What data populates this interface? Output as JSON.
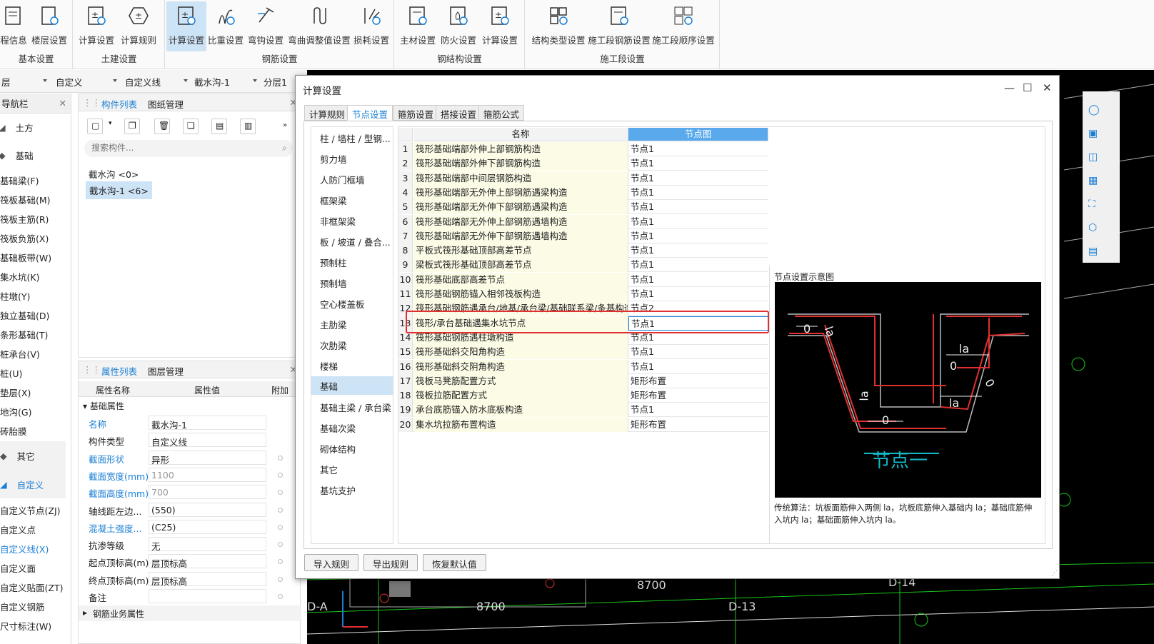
{
  "ribbon": {
    "groups": [
      {
        "title": "基本设置",
        "items": [
          "程信息",
          "楼层设置"
        ]
      },
      {
        "title": "土建设置",
        "items": [
          "计算设置",
          "计算规则"
        ]
      },
      {
        "title": "钢筋设置",
        "items": [
          "计算设置",
          "比重设置",
          "弯钩设置",
          "弯曲调整值设置",
          "损耗设置"
        ]
      },
      {
        "title": "钢结构设置",
        "items": [
          "主材设置",
          "防火设置",
          "计算设置"
        ]
      },
      {
        "title": "施工段设置",
        "items": [
          "结构类型设置",
          "施工段钢筋设置",
          "施工段顺序设置"
        ]
      }
    ]
  },
  "selbar": {
    "s0": "层",
    "s1": "自定义",
    "s2": "自定义线",
    "s3": "截水沟-1",
    "s4": "分层1"
  },
  "nav": {
    "title": "导航栏",
    "cat_tufang": "土方",
    "cat_jichu": "基础",
    "items": [
      "基础梁(F)",
      "筏板基础(M)",
      "筏板主筋(R)",
      "筏板负筋(X)",
      "基础板带(W)",
      "集水坑(K)",
      "柱墩(Y)",
      "独立基础(D)",
      "条形基础(T)",
      "桩承台(V)",
      "桩(U)",
      "垫层(X)",
      "地沟(G)",
      "砖胎膜"
    ],
    "cat_qita": "其它",
    "cat_zidingyi": "自定义",
    "items2": [
      "自定义节点(ZJ)",
      "自定义点",
      "自定义线(X)",
      "自定义面",
      "自定义贴面(ZT)",
      "自定义钢筋",
      "尺寸标注(W)"
    ]
  },
  "comp": {
    "tab1": "构件列表",
    "tab2": "图纸管理",
    "search_placeholder": "搜索构件...",
    "tree_root": "截水沟 <0>",
    "tree_child": "截水沟-1 <6>"
  },
  "props": {
    "tab1": "属性列表",
    "tab2": "图层管理",
    "col1": "属性名称",
    "col2": "属性值",
    "col3": "附加",
    "group": "基础属性",
    "rows": [
      {
        "k": "名称",
        "v": "截水沟-1"
      },
      {
        "k": "构件类型",
        "v": "自定义线"
      },
      {
        "k": "截面形状",
        "v": "异形"
      },
      {
        "k": "截面宽度(mm)",
        "v": "1100"
      },
      {
        "k": "截面高度(mm)",
        "v": "700"
      },
      {
        "k": "轴线距左边...",
        "v": "(550)"
      },
      {
        "k": "混凝土强度...",
        "v": "(C25)"
      },
      {
        "k": "抗渗等级",
        "v": "无"
      },
      {
        "k": "起点顶标高(m)",
        "v": "层顶标高"
      },
      {
        "k": "终点顶标高(m)",
        "v": "层顶标高"
      },
      {
        "k": "备注",
        "v": ""
      }
    ],
    "group2": "钢筋业务属性"
  },
  "dialog": {
    "title": "计算设置",
    "tabs": [
      "计算规则",
      "节点设置",
      "箍筋设置",
      "搭接设置",
      "箍筋公式"
    ],
    "categories": [
      "柱 / 墙柱 / 型钢...",
      "剪力墙",
      "人防门框墙",
      "框架梁",
      "非框架梁",
      "板 / 坡道 / 叠合...",
      "预制柱",
      "预制墙",
      "空心楼盖板",
      "主肋梁",
      "次肋梁",
      "楼梯",
      "基础",
      "基础主梁 / 承台梁",
      "基础次梁",
      "砌体结构",
      "其它",
      "基坑支护"
    ],
    "col_name": "名称",
    "col_node": "节点图",
    "rows": [
      {
        "n": "1",
        "name": "筏形基础端部外伸上部钢筋构造",
        "node": "节点1"
      },
      {
        "n": "2",
        "name": "筏形基础端部外伸下部钢筋构造",
        "node": "节点1"
      },
      {
        "n": "3",
        "name": "筏形基础端部中间层钢筋构造",
        "node": "节点1"
      },
      {
        "n": "4",
        "name": "筏形基础端部无外伸上部钢筋遇梁构造",
        "node": "节点1"
      },
      {
        "n": "5",
        "name": "筏形基础端部无外伸下部钢筋遇梁构造",
        "node": "节点1"
      },
      {
        "n": "6",
        "name": "筏形基础端部无外伸上部钢筋遇墙构造",
        "node": "节点1"
      },
      {
        "n": "7",
        "name": "筏形基础端部无外伸下部钢筋遇墙构造",
        "node": "节点1"
      },
      {
        "n": "8",
        "name": "平板式筏形基础顶部高差节点",
        "node": "节点1"
      },
      {
        "n": "9",
        "name": "梁板式筏形基础顶部高差节点",
        "node": "节点1"
      },
      {
        "n": "10",
        "name": "筏形基础底部高差节点",
        "node": "节点1"
      },
      {
        "n": "11",
        "name": "筏形基础钢筋锚入相邻筏板构造",
        "node": "节点1"
      },
      {
        "n": "12",
        "name": "筏形基础钢筋遇承台/地基/承台梁/基础联系梁/条基构造",
        "node": "节点2"
      },
      {
        "n": "13",
        "name": "筏形/承台基础遇集水坑节点",
        "node": "节点1"
      },
      {
        "n": "14",
        "name": "筏形基础钢筋遇柱墩构造",
        "node": "节点1"
      },
      {
        "n": "15",
        "name": "筏形基础斜交阳角构造",
        "node": "节点1"
      },
      {
        "n": "16",
        "name": "筏形基础斜交阴角构造",
        "node": "节点1"
      },
      {
        "n": "17",
        "name": "筏板马凳筋配置方式",
        "node": "矩形布置"
      },
      {
        "n": "18",
        "name": "筏板拉筋配置方式",
        "node": "矩形布置"
      },
      {
        "n": "19",
        "name": "承台底筋锚入防水底板构造",
        "node": "节点1"
      },
      {
        "n": "20",
        "name": "集水坑拉筋布置构造",
        "node": "矩形布置"
      }
    ],
    "preview_title": "节点设置示意图",
    "diagram_caption": "节点一",
    "diagram_labels": {
      "la1": "la",
      "la2": "la",
      "la3": "la",
      "la4": "la",
      "z1": "0",
      "z2": "0",
      "z3": "0",
      "z4": "0"
    },
    "preview_desc": "传统算法：坑板面筋伸入两侧 la，坑板底筋伸入基础内 la；基础底筋伸入坑内 la；基础面筋伸入坑内 la。",
    "btn_import": "导入规则",
    "btn_export": "导出规则",
    "btn_reset": "恢复默认值"
  },
  "cad": {
    "dim1": "8700",
    "dim2": "8700",
    "axis1": "D-A",
    "axis2": "D-13",
    "axis3": "D-14"
  },
  "colors": {
    "accent": "#1a7fd4",
    "highlight": "#e03030",
    "selectedRow": "#cde3f6"
  }
}
